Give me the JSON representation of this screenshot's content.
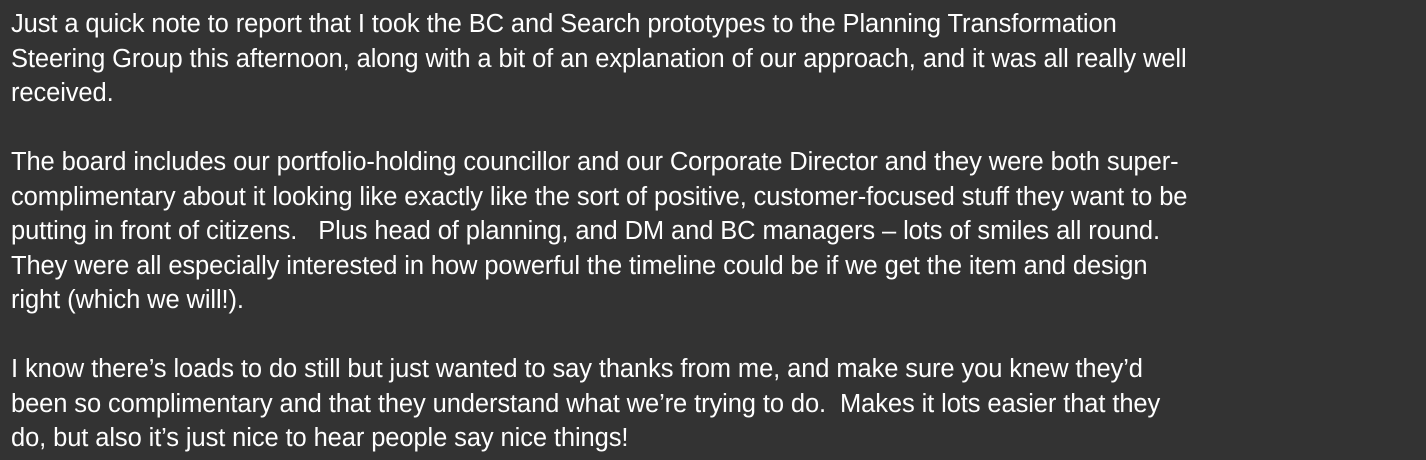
{
  "paragraphs": [
    [
      "Just a quick note to report that I took the BC and Search prototypes to the Planning Transformation",
      "Steering Group this afternoon, along with a bit of an explanation of our approach, and it was all really well",
      "received."
    ],
    [
      "The board includes our portfolio-holding councillor and our Corporate Director and they were both super-",
      "complimentary about it looking like exactly like the sort of positive, customer-focused stuff they want to be",
      "putting in front of citizens.   Plus head of planning, and DM and BC managers – lots of smiles all round.",
      "They were all especially interested in how powerful the timeline could be if we get the item and design",
      "right (which we will!)."
    ],
    [
      "I know there’s loads to do still but just wanted to say thanks from me, and make sure you knew they’d",
      "been so complimentary and that they understand what we’re trying to do.  Makes it lots easier that they",
      "do, but also it’s just nice to hear people say nice things!"
    ]
  ]
}
